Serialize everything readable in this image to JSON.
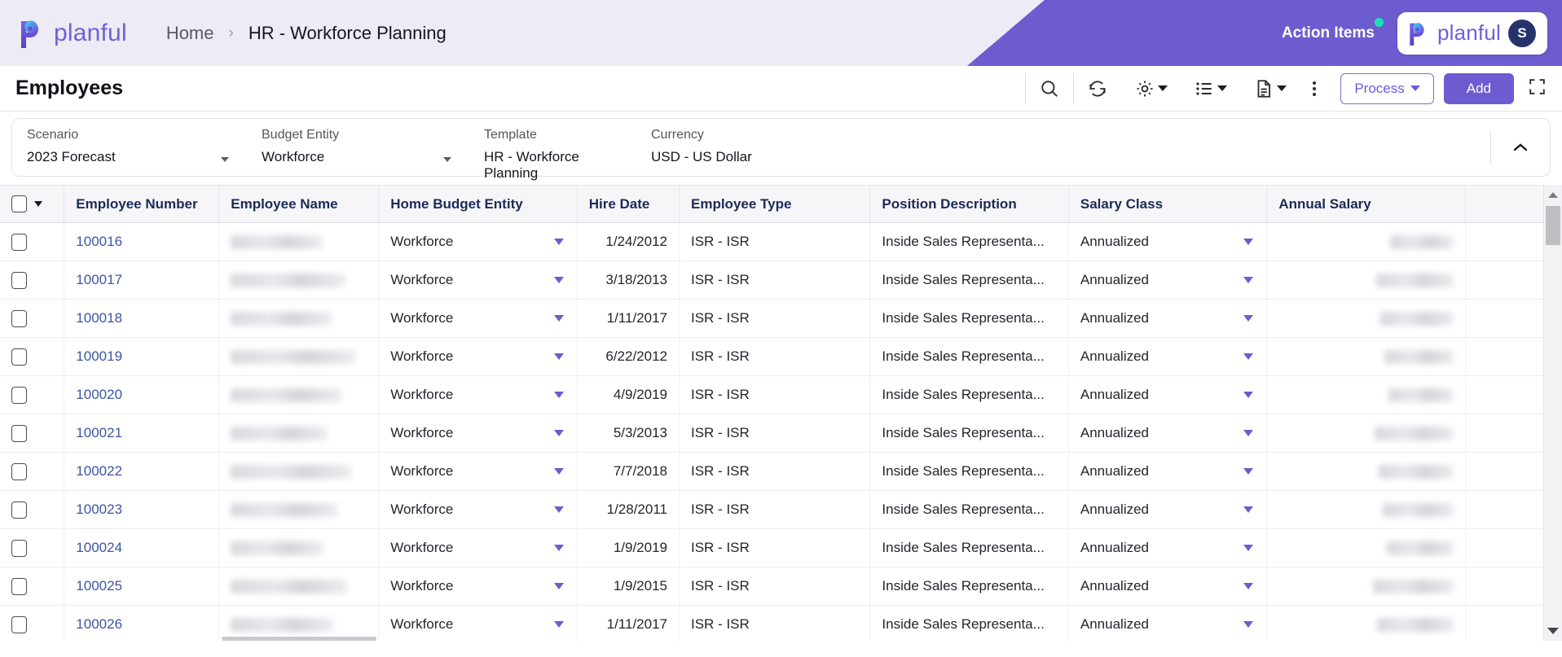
{
  "app": {
    "brand": "planful",
    "logo_icon": "planful-logo-icon",
    "accent_purple": "#6c5ccf",
    "accent_link": "#3c55a5",
    "notification_color": "#18e0b5"
  },
  "topbar": {
    "breadcrumb": {
      "home": "Home",
      "separator": "›",
      "current": "HR - Workforce Planning"
    },
    "action_items_label": "Action Items",
    "notification_dot": true,
    "user_avatar_initial": "S"
  },
  "toolbar": {
    "page_title": "Employees",
    "icons": [
      {
        "name": "search-icon",
        "has_caret": false
      },
      {
        "name": "refresh-icon",
        "has_caret": false
      },
      {
        "name": "gear-icon",
        "has_caret": true
      },
      {
        "name": "list-view-icon",
        "has_caret": true
      },
      {
        "name": "document-icon",
        "has_caret": true
      },
      {
        "name": "more-vertical-icon",
        "has_caret": false
      }
    ],
    "process_label": "Process",
    "add_label": "Add",
    "expand_icon": "fullscreen-icon"
  },
  "filters": {
    "collapse_icon": "chevron-up-icon",
    "fields": [
      {
        "label": "Scenario",
        "value": "2023 Forecast",
        "has_dropdown": true
      },
      {
        "label": "Budget Entity",
        "value": "Workforce",
        "has_dropdown": true
      },
      {
        "label": "Template",
        "value": "HR - Workforce Planning",
        "has_dropdown": false
      },
      {
        "label": "Currency",
        "value": "USD - US Dollar",
        "has_dropdown": false
      }
    ]
  },
  "grid": {
    "columns": [
      "Employee Number",
      "Employee Name",
      "Home Budget Entity",
      "Hire Date",
      "Employee Type",
      "Position Description",
      "Salary Class",
      "Annual Salary"
    ],
    "rows": [
      {
        "employee_number": "100016",
        "employee_name": "",
        "home_budget_entity": "Workforce",
        "hire_date": "1/24/2012",
        "employee_type": "ISR - ISR",
        "position_description": "Inside Sales Representa...",
        "salary_class": "Annualized",
        "annual_salary": ""
      },
      {
        "employee_number": "100017",
        "employee_name": "",
        "home_budget_entity": "Workforce",
        "hire_date": "3/18/2013",
        "employee_type": "ISR - ISR",
        "position_description": "Inside Sales Representa...",
        "salary_class": "Annualized",
        "annual_salary": ""
      },
      {
        "employee_number": "100018",
        "employee_name": "",
        "home_budget_entity": "Workforce",
        "hire_date": "1/11/2017",
        "employee_type": "ISR - ISR",
        "position_description": "Inside Sales Representa...",
        "salary_class": "Annualized",
        "annual_salary": ""
      },
      {
        "employee_number": "100019",
        "employee_name": "",
        "home_budget_entity": "Workforce",
        "hire_date": "6/22/2012",
        "employee_type": "ISR - ISR",
        "position_description": "Inside Sales Representa...",
        "salary_class": "Annualized",
        "annual_salary": ""
      },
      {
        "employee_number": "100020",
        "employee_name": "",
        "home_budget_entity": "Workforce",
        "hire_date": "4/9/2019",
        "employee_type": "ISR - ISR",
        "position_description": "Inside Sales Representa...",
        "salary_class": "Annualized",
        "annual_salary": ""
      },
      {
        "employee_number": "100021",
        "employee_name": "",
        "home_budget_entity": "Workforce",
        "hire_date": "5/3/2013",
        "employee_type": "ISR - ISR",
        "position_description": "Inside Sales Representa...",
        "salary_class": "Annualized",
        "annual_salary": ""
      },
      {
        "employee_number": "100022",
        "employee_name": "",
        "home_budget_entity": "Workforce",
        "hire_date": "7/7/2018",
        "employee_type": "ISR - ISR",
        "position_description": "Inside Sales Representa...",
        "salary_class": "Annualized",
        "annual_salary": ""
      },
      {
        "employee_number": "100023",
        "employee_name": "",
        "home_budget_entity": "Workforce",
        "hire_date": "1/28/2011",
        "employee_type": "ISR - ISR",
        "position_description": "Inside Sales Representa...",
        "salary_class": "Annualized",
        "annual_salary": ""
      },
      {
        "employee_number": "100024",
        "employee_name": "",
        "home_budget_entity": "Workforce",
        "hire_date": "1/9/2019",
        "employee_type": "ISR - ISR",
        "position_description": "Inside Sales Representa...",
        "salary_class": "Annualized",
        "annual_salary": ""
      },
      {
        "employee_number": "100025",
        "employee_name": "",
        "home_budget_entity": "Workforce",
        "hire_date": "1/9/2015",
        "employee_type": "ISR - ISR",
        "position_description": "Inside Sales Representa...",
        "salary_class": "Annualized",
        "annual_salary": ""
      },
      {
        "employee_number": "100026",
        "employee_name": "",
        "home_budget_entity": "Workforce",
        "hire_date": "1/11/2017",
        "employee_type": "ISR - ISR",
        "position_description": "Inside Sales Representa...",
        "salary_class": "Annualized",
        "annual_salary": ""
      }
    ],
    "redacted_columns": [
      "Employee Name",
      "Annual Salary"
    ],
    "scrollbar": {
      "vertical": true,
      "thumb_position": "near-top"
    }
  }
}
